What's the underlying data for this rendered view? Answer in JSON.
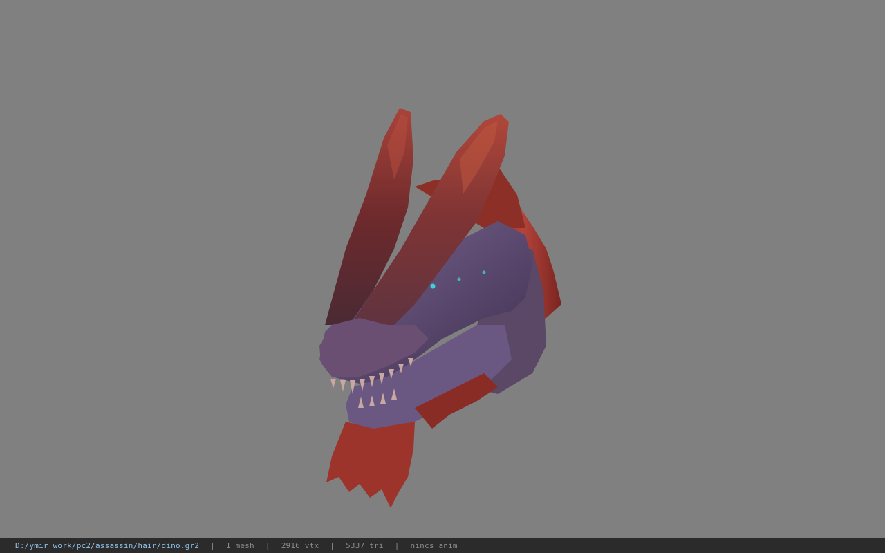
{
  "viewport": {
    "background_color": "#808080",
    "model_name": "dino head model",
    "accent_colors": {
      "horn": "#8a2e2a",
      "skin": "#6e5a86",
      "frill": "#9a3328",
      "eye": "#3fd0d8"
    }
  },
  "status_bar": {
    "path": "D:/ymir work/pc2/assassin/hair/dino.gr2",
    "separator": "|",
    "mesh": "1 mesh",
    "vtx": "2916 vtx",
    "tri": "5337 tri",
    "anim": "nincs anim"
  }
}
